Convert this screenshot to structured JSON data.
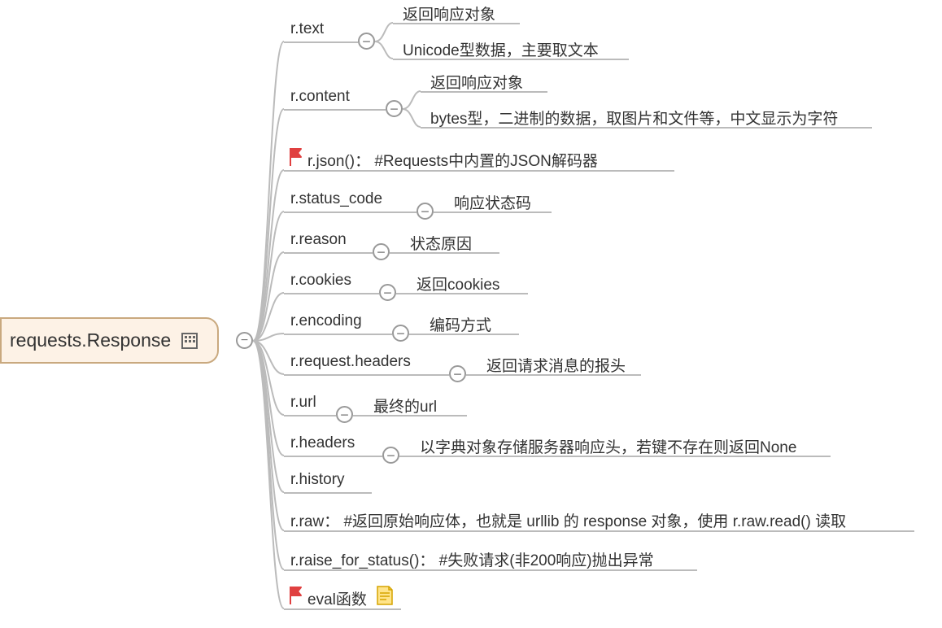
{
  "root": {
    "label": "requests.Response"
  },
  "nodes": {
    "text": {
      "label": "r.text",
      "children": [
        "返回响应对象",
        "Unicode型数据，主要取文本"
      ]
    },
    "content": {
      "label": "r.content",
      "children": [
        "返回响应对象",
        "bytes型，二进制的数据，取图片和文件等，中文显示为字符"
      ]
    },
    "json": {
      "label": "r.json()：  #Requests中内置的JSON解码器"
    },
    "status": {
      "label": "r.status_code",
      "children": [
        "响应状态码"
      ]
    },
    "reason": {
      "label": "r.reason",
      "children": [
        "状态原因"
      ]
    },
    "cookies": {
      "label": "r.cookies",
      "children": [
        "返回cookies"
      ]
    },
    "encoding": {
      "label": "r.encoding",
      "children": [
        "编码方式"
      ]
    },
    "reqhdr": {
      "label": "r.request.headers",
      "children": [
        "返回请求消息的报头"
      ]
    },
    "url": {
      "label": "r.url",
      "children": [
        "最终的url"
      ]
    },
    "headers": {
      "label": "r.headers",
      "children": [
        "以字典对象存储服务器响应头，若键不存在则返回None"
      ]
    },
    "history": {
      "label": "r.history"
    },
    "raw": {
      "label": "r.raw：  #返回原始响应体，也就是 urllib 的 response 对象，使用 r.raw.read() 读取"
    },
    "raise": {
      "label": "r.raise_for_status()：  #失败请求(非200响应)抛出异常"
    },
    "eval": {
      "label": "eval函数"
    }
  }
}
